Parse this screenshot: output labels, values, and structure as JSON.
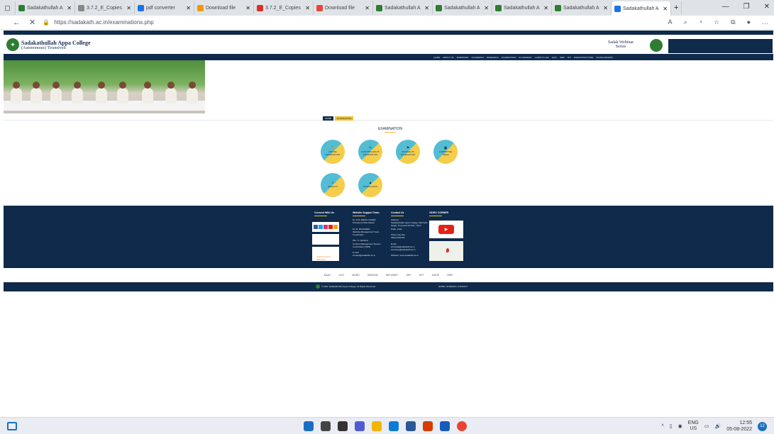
{
  "browser": {
    "tabs": [
      {
        "title": "Sadakathullah A",
        "color": "#2e7d32"
      },
      {
        "title": "3.7.2_E_Copies",
        "color": "#888888"
      },
      {
        "title": "pdf converter",
        "color": "#1a73e8"
      },
      {
        "title": "Download file",
        "color": "#f29900"
      },
      {
        "title": "3.7.2_E_Copies",
        "color": "#d93025"
      },
      {
        "title": "Download file",
        "color": "#e8453c"
      },
      {
        "title": "Sadakathullah A",
        "color": "#2e7d32"
      },
      {
        "title": "Sadakathullah A",
        "color": "#2e7d32"
      },
      {
        "title": "Sadakathullah A",
        "color": "#2e7d32"
      },
      {
        "title": "Sadakathullah A",
        "color": "#2e7d32"
      },
      {
        "title": "Sadakathullah A",
        "color": "#1a73e8"
      }
    ],
    "url": "https://sadakath.ac.in/examinations.php"
  },
  "site": {
    "college_name": "Sadakathullah Appa College",
    "college_sub": "(Autonomous) Tirunelveli",
    "webinar": "Sadak Webinar Series",
    "nav": [
      "HOME",
      "ABOUT US",
      "ADMISSION",
      "ACADEMICS",
      "RESEARCH",
      "EXAMINATION",
      "PLACEMENT",
      "CAMPUS LIFE",
      "IQAC",
      "NIRF",
      "RTI",
      "INFRASTRUCTURE",
      "SCHOLARSHIPS"
    ],
    "breadcrumb": {
      "home": "HOME",
      "current": "EXAMINATION"
    },
    "page_title": "EXAMINATION",
    "cards": [
      {
        "label": "ONLINE EXAMINATION",
        "icon": "⛹"
      },
      {
        "label": "CONTROLLER OF EXAMINATION",
        "icon": "✎"
      },
      {
        "label": "SCHEME OF EXAMINATION",
        "icon": "⚑"
      },
      {
        "label": "COMMITTEE TABLE",
        "icon": "▣"
      },
      {
        "label": "RESULTS",
        "icon": "⌕"
      },
      {
        "label": "DOWNLOADS",
        "icon": "▲"
      }
    ],
    "footer": {
      "connect_title": "Connect With Us",
      "support_title": "Website Support Team",
      "support_text": "Dr. S.M. ABDUL KADER\nPrincipal & Web Master\n\nDr. M. MOHAMED\nWebsite Management Team\nCoordinator\n\nMrs. S. Nandhini\nContent Management System\nCoordinator (CMS)\n\nE-mail\ncontact@sadakath.ac.in",
      "contact_title": "Contact Us",
      "contact_text": "Address\nSadakathullah Appa College, Rahmath\nNagar, Tirunelveli 627011, Tamil\nNadu, India.\n\nPhone Number\n0462-2540763\n\nEmail\nprincipal@sadakath.ac.in\nsecretary@sadakath.ac.in\n\nWebsite: www.sadakath.ac.in",
      "video_title": "VIDEO CORNER",
      "azadi": "Azadi Ka Amrit Mahotsav"
    },
    "partners": [
      "NAAC",
      "UGC",
      "MHRD",
      "SWAYAM",
      "INFLIBNET",
      "DBT",
      "DST",
      "AISHE",
      "NIRF"
    ],
    "copyright": "© 2021 Sadakathullah Appa College. All Rights Reserved.",
    "footer_links": "HOME  |  SITEMAP  |  CONTACT"
  },
  "taskbar": {
    "lang": "ENG",
    "region": "US",
    "time": "12:55",
    "date": "05-08-2022",
    "notif": "12"
  }
}
